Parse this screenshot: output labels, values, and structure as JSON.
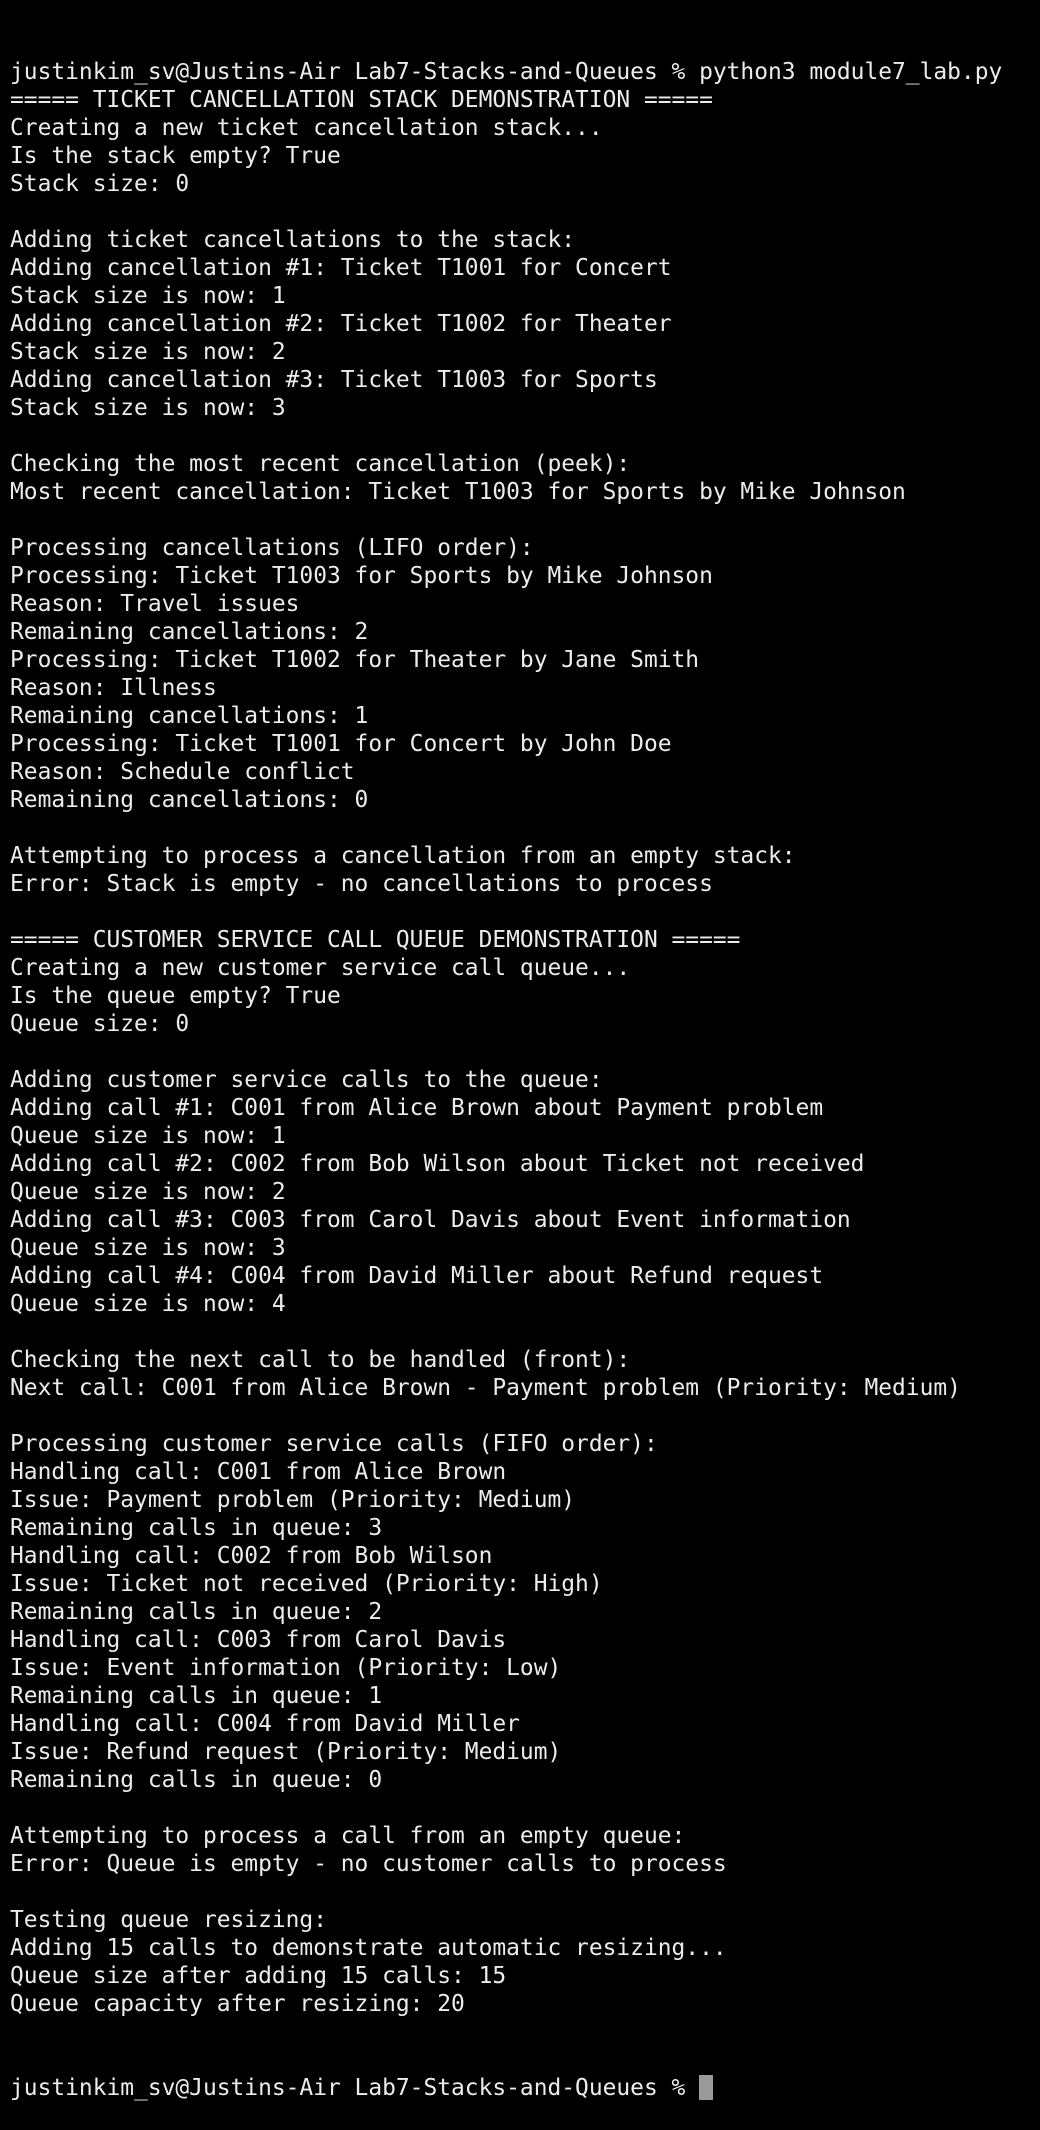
{
  "terminal": {
    "lines": [
      "justinkim_sv@Justins-Air Lab7-Stacks-and-Queues % python3 module7_lab.py",
      "===== TICKET CANCELLATION STACK DEMONSTRATION =====",
      "Creating a new ticket cancellation stack...",
      "Is the stack empty? True",
      "Stack size: 0",
      "",
      "Adding ticket cancellations to the stack:",
      "Adding cancellation #1: Ticket T1001 for Concert",
      "Stack size is now: 1",
      "Adding cancellation #2: Ticket T1002 for Theater",
      "Stack size is now: 2",
      "Adding cancellation #3: Ticket T1003 for Sports",
      "Stack size is now: 3",
      "",
      "Checking the most recent cancellation (peek):",
      "Most recent cancellation: Ticket T1003 for Sports by Mike Johnson",
      "",
      "Processing cancellations (LIFO order):",
      "Processing: Ticket T1003 for Sports by Mike Johnson",
      "Reason: Travel issues",
      "Remaining cancellations: 2",
      "Processing: Ticket T1002 for Theater by Jane Smith",
      "Reason: Illness",
      "Remaining cancellations: 1",
      "Processing: Ticket T1001 for Concert by John Doe",
      "Reason: Schedule conflict",
      "Remaining cancellations: 0",
      "",
      "Attempting to process a cancellation from an empty stack:",
      "Error: Stack is empty - no cancellations to process",
      "",
      "===== CUSTOMER SERVICE CALL QUEUE DEMONSTRATION =====",
      "Creating a new customer service call queue...",
      "Is the queue empty? True",
      "Queue size: 0",
      "",
      "Adding customer service calls to the queue:",
      "Adding call #1: C001 from Alice Brown about Payment problem",
      "Queue size is now: 1",
      "Adding call #2: C002 from Bob Wilson about Ticket not received",
      "Queue size is now: 2",
      "Adding call #3: C003 from Carol Davis about Event information",
      "Queue size is now: 3",
      "Adding call #4: C004 from David Miller about Refund request",
      "Queue size is now: 4",
      "",
      "Checking the next call to be handled (front):",
      "Next call: C001 from Alice Brown - Payment problem (Priority: Medium)",
      "",
      "Processing customer service calls (FIFO order):",
      "Handling call: C001 from Alice Brown",
      "Issue: Payment problem (Priority: Medium)",
      "Remaining calls in queue: 3",
      "Handling call: C002 from Bob Wilson",
      "Issue: Ticket not received (Priority: High)",
      "Remaining calls in queue: 2",
      "Handling call: C003 from Carol Davis",
      "Issue: Event information (Priority: Low)",
      "Remaining calls in queue: 1",
      "Handling call: C004 from David Miller",
      "Issue: Refund request (Priority: Medium)",
      "Remaining calls in queue: 0",
      "",
      "Attempting to process a call from an empty queue:",
      "Error: Queue is empty - no customer calls to process",
      "",
      "Testing queue resizing:",
      "Adding 15 calls to demonstrate automatic resizing...",
      "Queue size after adding 15 calls: 15",
      "Queue capacity after resizing: 20"
    ],
    "prompt": "justinkim_sv@Justins-Air Lab7-Stacks-and-Queues % "
  },
  "colors": {
    "background": "#000000",
    "text": "#ececec",
    "cursor": "#9a9a9a"
  }
}
